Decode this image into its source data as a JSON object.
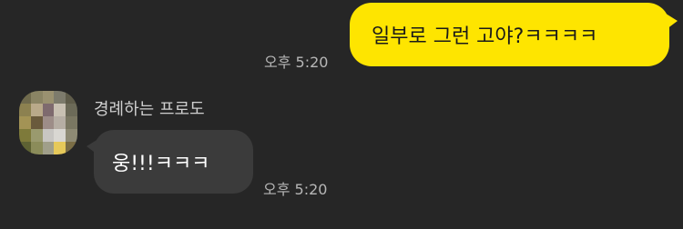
{
  "colors": {
    "background": "#262626",
    "outgoing_bubble": "#FEE500",
    "incoming_bubble": "#3b3b3b",
    "timestamp": "#b7b7b7"
  },
  "messages": [
    {
      "direction": "outgoing",
      "text": "일부로 그런 고야?ㅋㅋㅋㅋ",
      "time": "오후 5:20"
    },
    {
      "direction": "incoming",
      "sender": "경례하는 프로도",
      "avatar_icon": "pixelated-avatar-icon",
      "text": "웅!!!ㅋㅋㅋ",
      "time": "오후 5:20"
    }
  ]
}
